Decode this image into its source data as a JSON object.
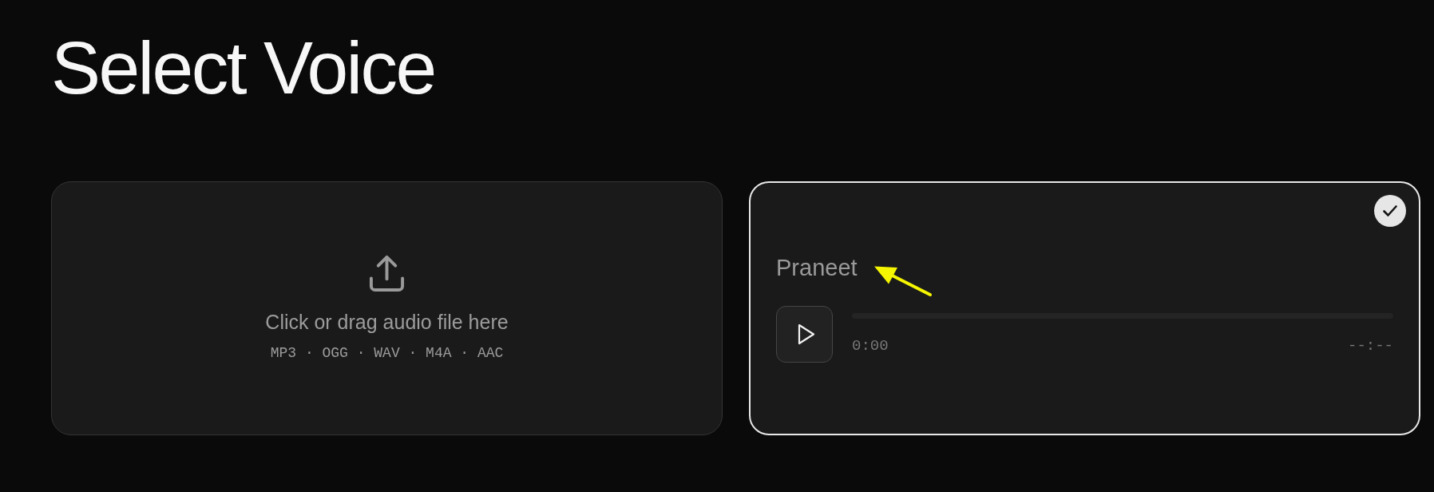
{
  "title": "Select Voice",
  "upload": {
    "instruction": "Click or drag audio file here",
    "formats": "MP3 · OGG · WAV · M4A · AAC"
  },
  "voices": [
    {
      "name": "Praneet",
      "selected": true,
      "player": {
        "level": 0,
        "elapsed": "0:00",
        "duration": "--:--"
      }
    }
  ],
  "annotation": {
    "kind": "arrow"
  }
}
